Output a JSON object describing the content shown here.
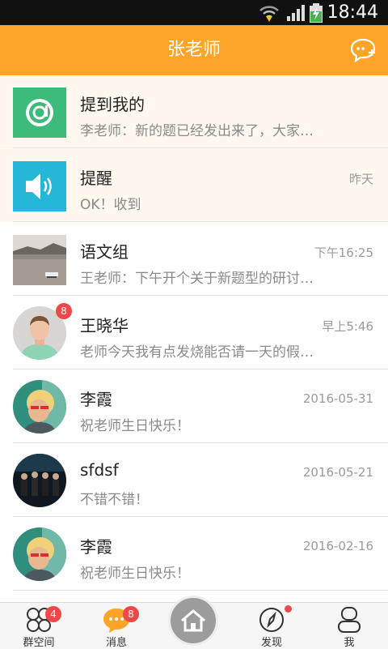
{
  "status_bar": {
    "time": "18:44"
  },
  "header": {
    "title": "张老师"
  },
  "conversations": [
    {
      "name": "提到我的",
      "message": "李老师：新的题已经发出来了，大家…",
      "time": "",
      "avatar": "at-icon",
      "highlight": true
    },
    {
      "name": "提醒",
      "message": "OK！收到",
      "time": "昨天",
      "avatar": "speaker-icon",
      "highlight": true
    },
    {
      "name": "语文组",
      "message": "王老师：下午开个关于新题型的研讨…",
      "time": "下午16:25",
      "avatar": "lake-photo"
    },
    {
      "name": "王晓华",
      "message": "老师今天我有点发烧能否请一天的假…",
      "time": "早上5:46",
      "avatar": "young-man-photo",
      "badge": "8"
    },
    {
      "name": "李霞",
      "message": "祝老师生日快乐！",
      "time": "2016-05-31",
      "avatar": "blonde-woman-photo"
    },
    {
      "name": "sfdsf",
      "message": "不错不错！",
      "time": "2016-05-21",
      "avatar": "band-photo"
    },
    {
      "name": "李霞",
      "message": "祝老师生日快乐！",
      "time": "2016-02-16",
      "avatar": "blonde-woman-photo"
    }
  ],
  "tabbar": {
    "tabs": [
      {
        "label": "群空间",
        "icon": "group-space-icon",
        "badge": "4"
      },
      {
        "label": "消息",
        "icon": "message-icon",
        "badge": "8"
      },
      {
        "label": "",
        "icon": "home-icon"
      },
      {
        "label": "发现",
        "icon": "compass-icon"
      },
      {
        "label": "我",
        "icon": "profile-icon"
      }
    ]
  },
  "colors": {
    "accent": "#fca529",
    "badge": "#f04848",
    "at_tile": "#3dbb7a",
    "speaker_tile": "#27b7d6"
  }
}
